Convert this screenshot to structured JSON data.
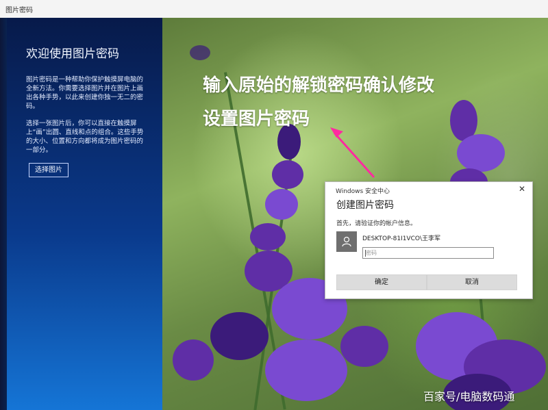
{
  "window": {
    "title": "图片密码"
  },
  "left_panel": {
    "heading": "欢迎使用图片密码",
    "description_1": "图片密码是一种帮助你保护触摸屏电脑的全新方法。你需要选择图片并在图片上画出各种手势，以此来创建你独一无二的密码。",
    "description_2": "选择一张图片后，你可以直接在触摸屏上“画”出圆、直线和点的组合。这些手势的大小、位置和方向都将成为图片密码的一部分。",
    "choose_button": "选择图片"
  },
  "annotation": {
    "line1": "输入原始的解锁密码确认修改",
    "line2": "设置图片密码",
    "arrow_color": "#ff2aa0"
  },
  "dialog": {
    "window_title": "Windows 安全中心",
    "heading": "创建图片密码",
    "prompt": "首先，请验证你的帐户信息。",
    "account": "DESKTOP-81I1VCO\\王李军",
    "password_placeholder": "密码",
    "ok_label": "确定",
    "cancel_label": "取消",
    "close_icon": "close-icon"
  },
  "watermark": "百家号/电脑数码通"
}
